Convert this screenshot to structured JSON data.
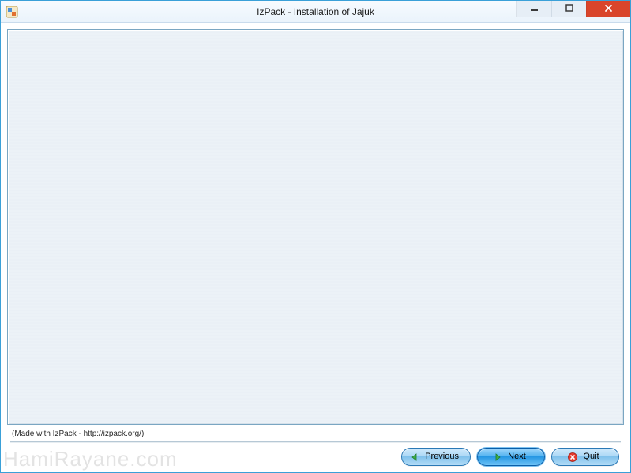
{
  "window": {
    "title": "IzPack - Installation of Jajuk"
  },
  "footer": {
    "credit": "(Made with IzPack - http://izpack.org/)"
  },
  "buttons": {
    "previous": {
      "label_pre": "",
      "label_underlined": "P",
      "label_post": "revious"
    },
    "next": {
      "label_pre": "",
      "label_underlined": "N",
      "label_post": "ext"
    },
    "quit": {
      "label_pre": "",
      "label_underlined": "Q",
      "label_post": "uit"
    }
  },
  "watermark": "HamiRayane.com"
}
